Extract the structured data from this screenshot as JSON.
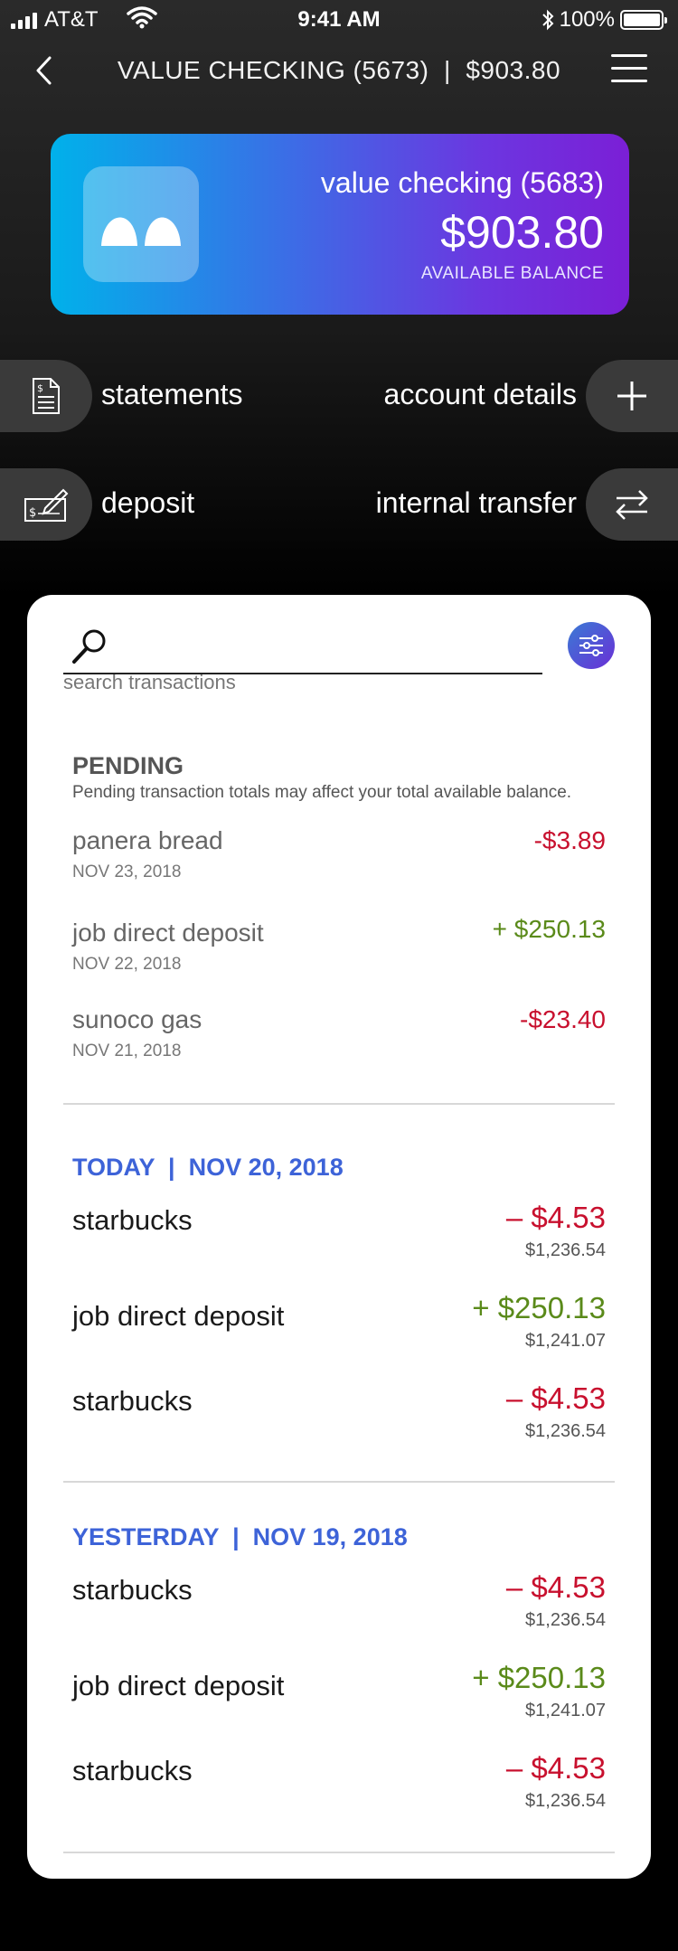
{
  "status_bar": {
    "carrier": "AT&T",
    "time": "9:41 AM",
    "battery": "100%"
  },
  "nav": {
    "title": "VALUE CHECKING (5673)  |  $903.80"
  },
  "card": {
    "account_name": "value checking (5683)",
    "balance": "$903.80",
    "balance_label": "AVAILABLE BALANCE"
  },
  "actions": {
    "statements": "statements",
    "account_details": "account details",
    "deposit": "deposit",
    "internal_transfer": "internal transfer"
  },
  "search": {
    "value": "",
    "hint": "search transactions"
  },
  "pending": {
    "title": "PENDING",
    "note": "Pending transaction totals may affect your total available balance.",
    "items": [
      {
        "name": "panera bread",
        "date": "NOV 23, 2018",
        "amount": "-$3.89",
        "kind": "neg"
      },
      {
        "name": "job direct deposit",
        "date": "NOV 22, 2018",
        "amount": "+ $250.13",
        "kind": "pos"
      },
      {
        "name": "sunoco gas",
        "date": "NOV 21, 2018",
        "amount": "-$23.40",
        "kind": "neg"
      }
    ]
  },
  "today": {
    "title": "TODAY  |  NOV 20, 2018",
    "items": [
      {
        "name": "starbucks",
        "amount": "– $4.53",
        "balance": "$1,236.54",
        "kind": "neg"
      },
      {
        "name": "job direct deposit",
        "amount": "+ $250.13",
        "balance": "$1,241.07",
        "kind": "pos"
      },
      {
        "name": "starbucks",
        "amount": "– $4.53",
        "balance": "$1,236.54",
        "kind": "neg"
      }
    ]
  },
  "yesterday": {
    "title": "YESTERDAY  |  NOV 19, 2018",
    "items": [
      {
        "name": "starbucks",
        "amount": "– $4.53",
        "balance": "$1,236.54",
        "kind": "neg"
      },
      {
        "name": "job direct deposit",
        "amount": "+ $250.13",
        "balance": "$1,241.07",
        "kind": "pos"
      },
      {
        "name": "starbucks",
        "amount": "– $4.53",
        "balance": "$1,236.54",
        "kind": "neg"
      }
    ]
  }
}
